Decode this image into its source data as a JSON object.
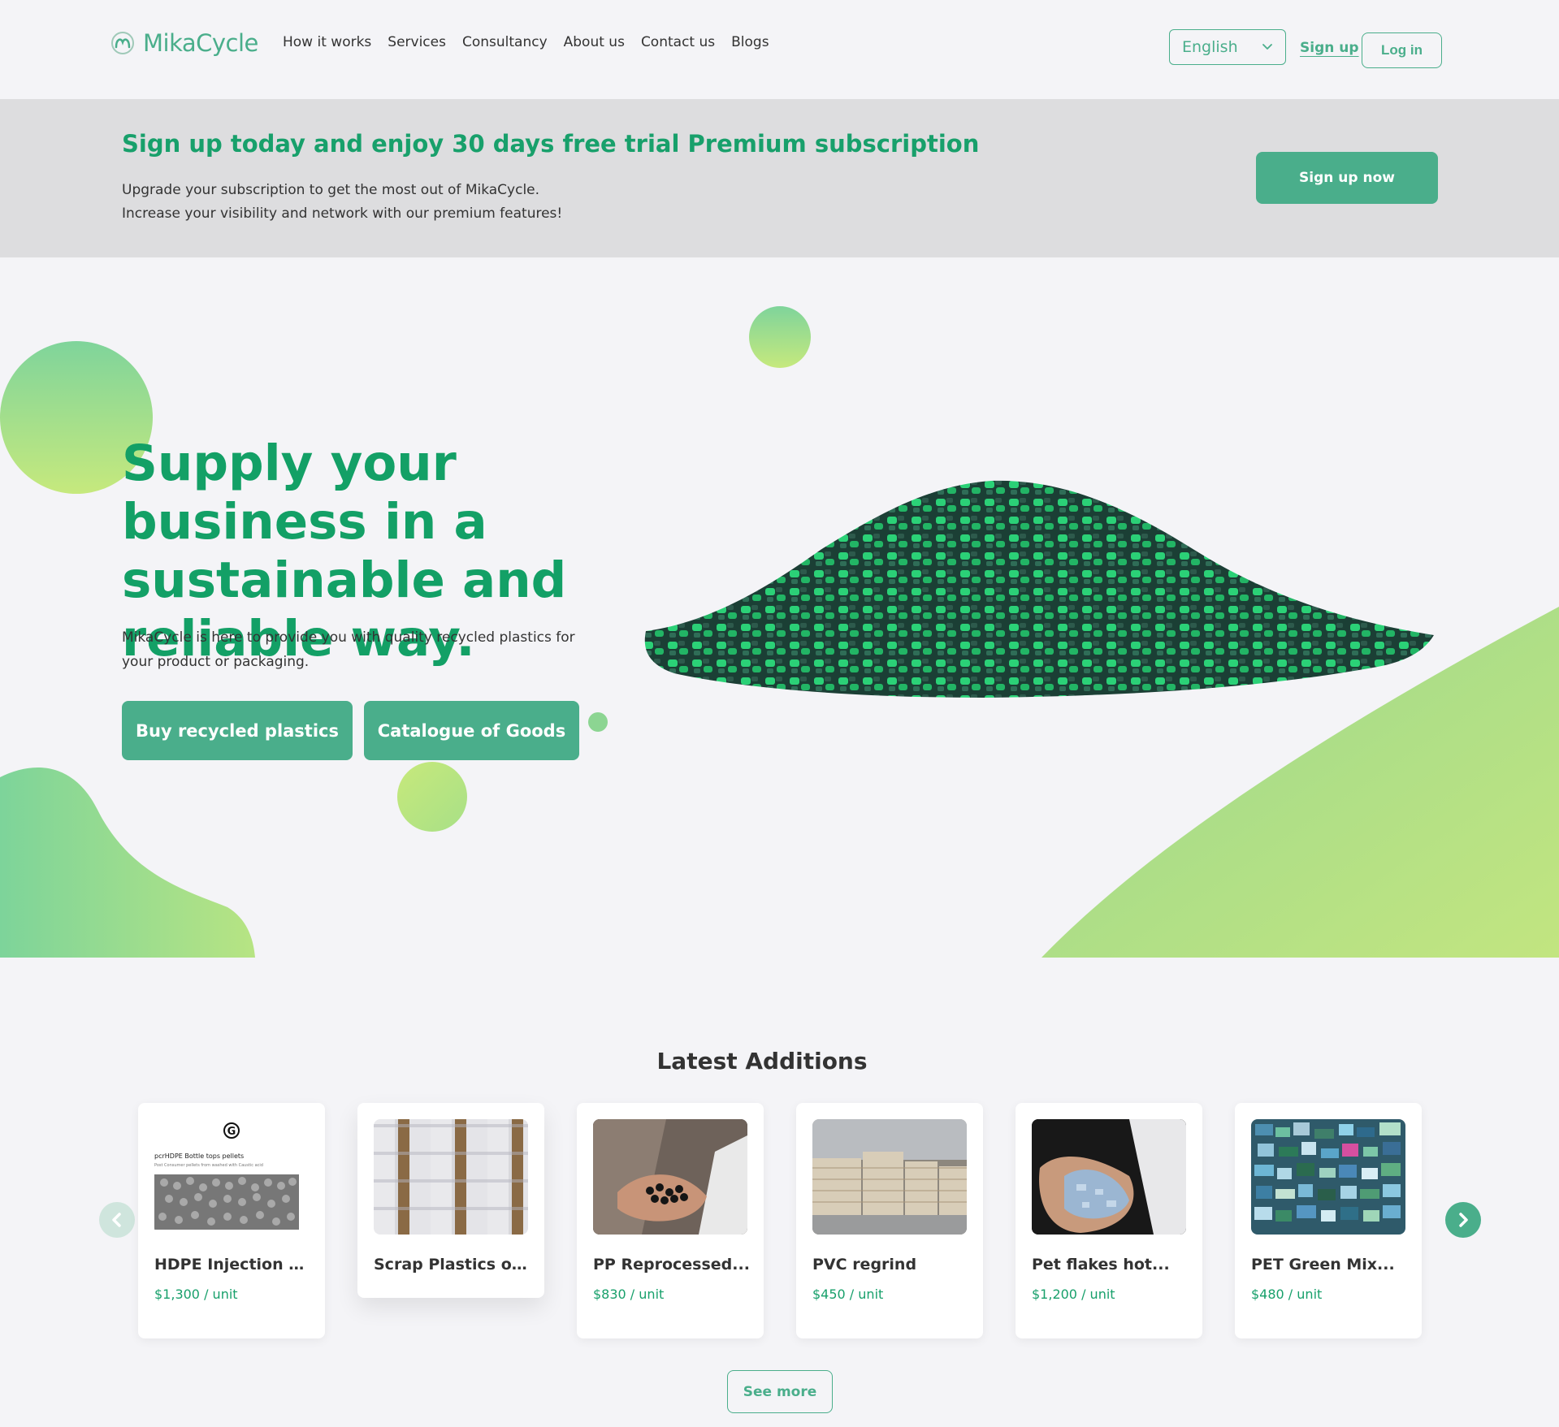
{
  "header": {
    "logo_text": "MikaCycle",
    "nav": [
      "How it works",
      "Services",
      "Consultancy",
      "About us",
      "Contact us",
      "Blogs"
    ],
    "language": "English",
    "signup_label": "Sign up",
    "login_label": "Log in"
  },
  "promo": {
    "title": "Sign up today and enjoy 30 days free trial Premium subscription",
    "line1": "Upgrade your subscription to get the most out of MikaCycle.",
    "line2": "Increase your visibility and network with our premium features!",
    "button_label": "Sign up now"
  },
  "hero": {
    "title": "Supply your business in a sustainable and reliable way.",
    "description": "MikaCycle is here to provide you with quality recycled plastics for your product or packaging.",
    "buy_label": "Buy recycled plastics",
    "catalogue_label": "Catalogue of Goods"
  },
  "latest": {
    "title": "Latest Additions",
    "products": [
      {
        "name": "HDPE Injection Ho...",
        "price": "$1,300 / unit",
        "image_text": {
          "logo": "G",
          "caption": "pcrHDPE Bottle tops pellets",
          "subcaption": "Post Consumer pellets from washed with Caustic acid"
        }
      },
      {
        "name": "Scrap Plastics of...",
        "price": ""
      },
      {
        "name": "PP Reprocessed...",
        "price": "$830 / unit"
      },
      {
        "name": "PVC regrind",
        "price": "$450 / unit"
      },
      {
        "name": "Pet flakes hot...",
        "price": "$1,200 / unit"
      },
      {
        "name": "PET Green Mix...",
        "price": "$480 / unit"
      }
    ],
    "see_more_label": "See more"
  },
  "colors": {
    "brand_green": "#4aae8b",
    "heading_green": "#13a066",
    "banner_gray": "#dddddf",
    "page_bg": "#f4f4f7"
  },
  "icons": [
    "mikacycle-logo-icon",
    "chevron-down-icon",
    "chevron-left-icon",
    "chevron-right-icon"
  ]
}
